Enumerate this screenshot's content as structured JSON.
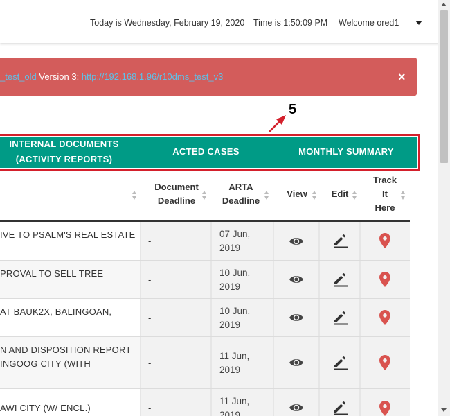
{
  "header": {
    "date_text": "Today is Wednesday, February 19, 2020",
    "time_text": "Time is 1:50:09 PM",
    "welcome_text": "Welcome ored1",
    "menu_icon": "caret-down-icon"
  },
  "alert": {
    "prefix_link": "_test_old",
    "version_label": " Version 3: ",
    "version_link": "http://192.168.1.96/r10dms_test_v3",
    "close_label": "×",
    "color": "#d35c5b"
  },
  "annotation": {
    "number": "5",
    "color": "#d4202c"
  },
  "tabs": [
    {
      "line1": "INTERNAL DOCUMENTS",
      "line2": "(ACTIVITY REPORTS)"
    },
    {
      "line1": "ACTED CASES"
    },
    {
      "line1": "MONTHLY SUMMARY"
    }
  ],
  "tab_color": "#009b86",
  "table": {
    "headers": {
      "document_deadline": [
        "Document",
        "Deadline"
      ],
      "arta_deadline": [
        "ARTA",
        "Deadline"
      ],
      "view": "View",
      "edit": "Edit",
      "track": [
        "Track",
        "It",
        "Here"
      ]
    },
    "rows": [
      {
        "title": [
          "IVE TO PSALM'S REAL ESTATE"
        ],
        "doc_deadline": "-",
        "arta": [
          "07 Jun,",
          "2019"
        ]
      },
      {
        "title": [
          "PROVAL TO SELL TREE"
        ],
        "doc_deadline": "-",
        "arta": [
          "10 Jun,",
          "2019"
        ]
      },
      {
        "title": [
          "AT BAUK2X, BALINGOAN,"
        ],
        "doc_deadline": "-",
        "arta": [
          "10 Jun,",
          "2019"
        ]
      },
      {
        "title": [
          "N AND DISPOSITION REPORT",
          "INGOOG CITY (WITH"
        ],
        "doc_deadline": "-",
        "arta": [
          "11 Jun,",
          "2019"
        ]
      },
      {
        "title": [
          "AWI CITY (W/ ENCL.)"
        ],
        "doc_deadline": "-",
        "arta": [
          "11 Jun,",
          "2019"
        ]
      }
    ],
    "icons": {
      "view": "eye-icon",
      "edit": "pencil-icon",
      "track": "map-pin-icon"
    },
    "pin_color": "#d9534f"
  }
}
